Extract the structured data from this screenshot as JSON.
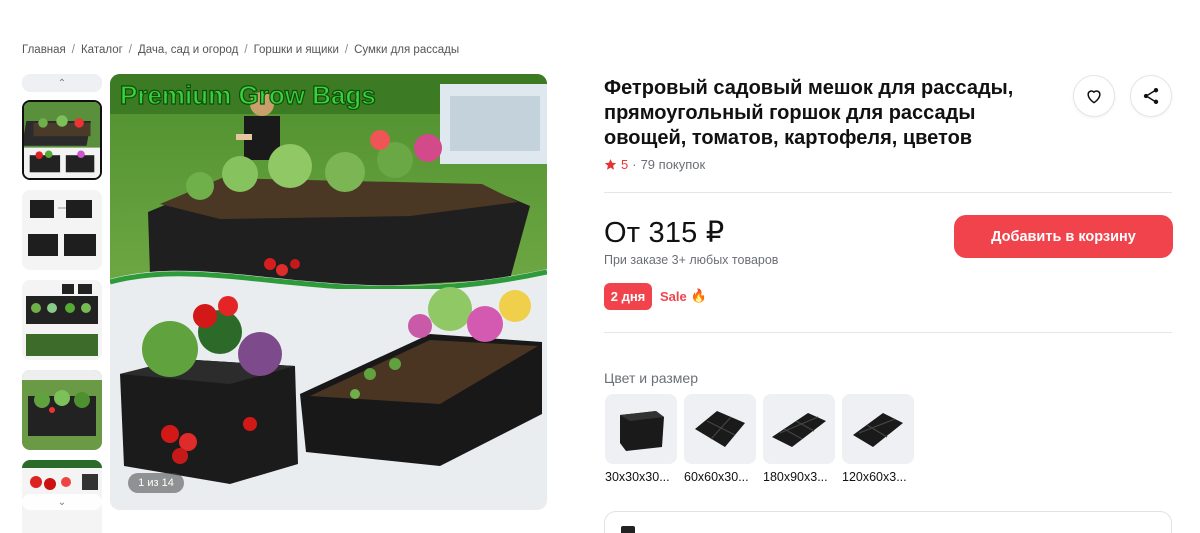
{
  "breadcrumb": [
    "Главная",
    "Каталог",
    "Дача, сад и огород",
    "Горшки и ящики",
    "Сумки для рассады"
  ],
  "gallery": {
    "counter": "1 из 14",
    "banner_text": "Premium Grow Bags"
  },
  "product": {
    "title": "Фетровый садовый мешок для рассады, прямоугольный горшок для рассады овощей, томатов, картофеля, цветов",
    "rating": "5",
    "purchases": "79 покупок",
    "price": "От 315 ₽",
    "price_note": "При заказе 3+ любых товаров",
    "days_badge": "2 дня",
    "sale_label": "Sale",
    "sale_emoji": "🔥",
    "cart_button": "Добавить в корзину",
    "variant_section_label": "Цвет и размер",
    "variants": [
      "30x30x30...",
      "60x60x30...",
      "180x90x3...",
      "120x60x3..."
    ]
  },
  "colors": {
    "accent": "#f0434c",
    "star": "#e33333"
  }
}
